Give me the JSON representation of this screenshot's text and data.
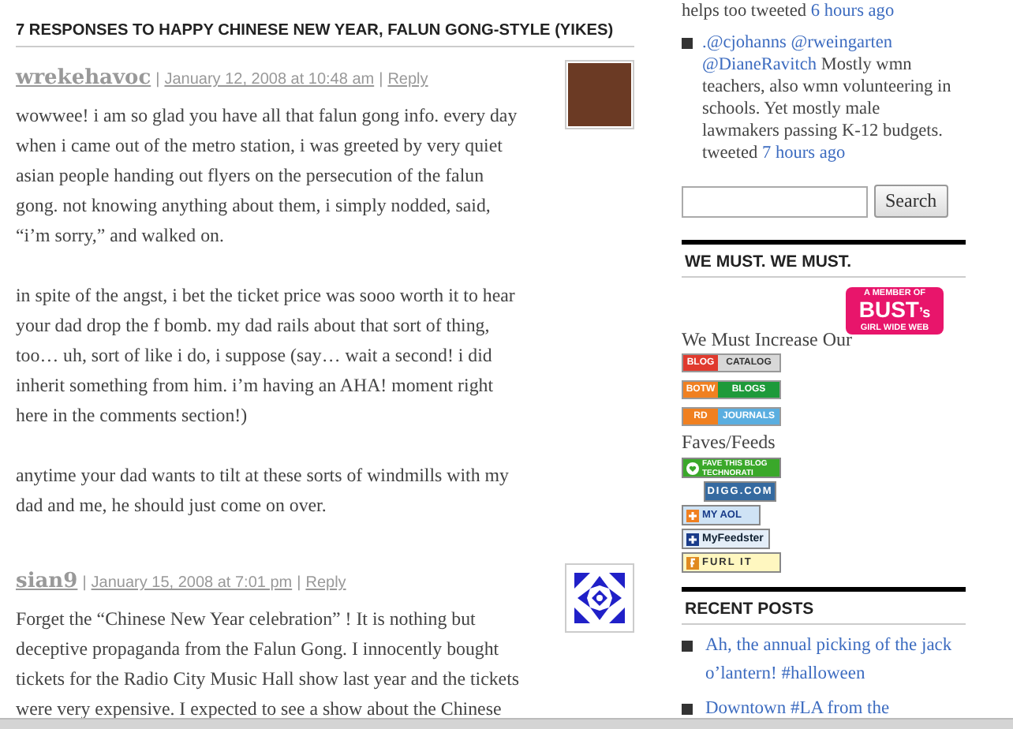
{
  "heading": "7 RESPONSES TO HAPPY CHINESE NEW YEAR, FALUN GONG-STYLE (YIKES)",
  "comments": [
    {
      "meta": [
        {
          "kind": "author",
          "text": "wrekehavoc"
        },
        {
          "kind": "separator",
          "text": "|"
        },
        {
          "kind": "date",
          "text": "January 12, 2008 at 10:48 am"
        },
        {
          "kind": "separator",
          "text": "|"
        },
        {
          "kind": "reply",
          "text": "Reply"
        }
      ],
      "avatar": {
        "kind": "photo"
      },
      "paragraphs": [
        "wowwee! i am so glad you have all that falun gong info. every day when i came out of the metro station, i was greeted by very quiet asian people handing out flyers on the persecution of the falun gong. not knowing anything about them, i simply nodded, said, “i’m sorry,” and walked on.",
        "in spite of the angst, i bet the ticket price was sooo worth it to hear your dad drop the f bomb. my dad rails about that sort of thing, too… uh, sort of like i do, i suppose (say… wait a second! i did inherit something from him. i’m having an AHA! moment right here in the comments section!)",
        "anytime your dad wants to tilt at these sorts of windmills with my dad and me, he should just come on over."
      ]
    },
    {
      "meta": [
        {
          "kind": "author",
          "text": "sian9"
        },
        {
          "kind": "separator",
          "text": "|"
        },
        {
          "kind": "date",
          "text": "January 15, 2008 at 7:01 pm"
        },
        {
          "kind": "separator",
          "text": "|"
        },
        {
          "kind": "reply",
          "text": "Reply"
        }
      ],
      "avatar": {
        "kind": "pattern"
      },
      "paragraphs": [
        "Forget the “Chinese New Year celebration” ! It is nothing but deceptive propaganda from the Falun Gong. I innocently bought tickets for the Radio City Music Hall show last year and the tickets were very expensive. I expected to see a show about the Chinese"
      ]
    }
  ],
  "sidebar": {
    "tweets": [
      {
        "bullet": false,
        "parts": [
          {
            "text": "helps too tweeted",
            "link": false
          },
          {
            "text": "6 hours ago",
            "link": true
          }
        ]
      },
      {
        "bullet": true,
        "parts": [
          {
            "text": ".@cjohanns",
            "link": true
          },
          {
            "text": "@rweingarten",
            "link": true
          },
          {
            "text": "@DianeRavitch",
            "link": true
          },
          {
            "text": "Mostly wmn teachers, also wmn volunteering in schools. Yet mostly male lawmakers passing K-12 budgets. tweeted",
            "link": false
          },
          {
            "text": "7 hours ago",
            "link": true
          }
        ]
      }
    ],
    "search": {
      "button": "Search"
    },
    "must_heading": "WE MUST. WE MUST.",
    "bust": {
      "top": "A MEMBER OF",
      "brand": "BUST",
      "suffix": "’s",
      "bottom": "GIRL WIDE WEB"
    },
    "increase_label": "We Must Increase Our",
    "increase_badges": [
      {
        "segments": [
          {
            "text": "BLOG",
            "color": "#e03a2e"
          },
          {
            "text": "CATALOG",
            "color": "#d8d8d8"
          }
        ]
      },
      {
        "segments": [
          {
            "text": "BOTW",
            "color": "#f08020"
          },
          {
            "text": "BLOGS",
            "color": "#1e9a3a"
          }
        ]
      },
      {
        "segments": [
          {
            "text": "RD",
            "color": "#f08020"
          },
          {
            "text": "JOURNALS",
            "color": "#5aaee0"
          }
        ]
      }
    ],
    "faves_label": "Faves/Feeds",
    "faves": [
      {
        "kind": "technorati",
        "text": "FAVE THIS BLOG TECHNORATI"
      },
      {
        "kind": "digg",
        "text": "DIGG.COM"
      },
      {
        "kind": "aol",
        "text": "MY AOL"
      },
      {
        "kind": "feedster",
        "text": "MyFeedster"
      },
      {
        "kind": "furl",
        "text": "FURL IT"
      }
    ],
    "recent_heading": "RECENT POSTS",
    "recent_posts": [
      "Ah, the annual picking of the jack o’lantern! #halloween",
      "Downtown #LA from the"
    ]
  }
}
